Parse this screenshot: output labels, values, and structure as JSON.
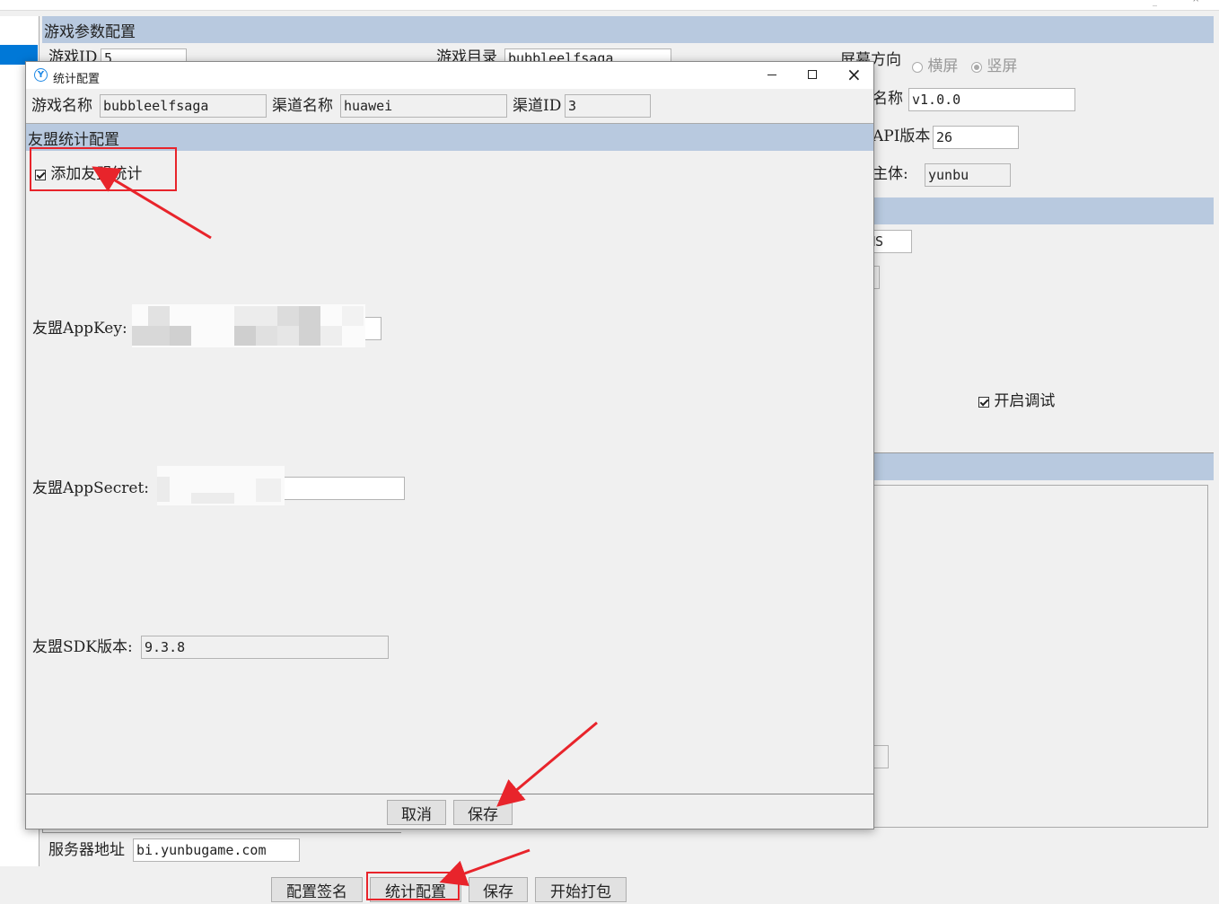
{
  "main_window": {
    "section_game_params": "游戏参数配置",
    "game_id_label": "游戏ID",
    "game_id_value": "5",
    "game_dir_label": "游戏目录",
    "game_dir_value": "bubbleelfsaga",
    "orientation_label": "屏幕方向",
    "orientation_landscape": "横屏",
    "orientation_portrait": "竖屏",
    "version_name_label": "名称",
    "version_name_value": "v1.0.0",
    "api_label": "API版本",
    "api_value": "26",
    "subject_label": "主体:",
    "subject_value": "yunbu",
    "ms_field_value": "MS",
    "debug_label": "开启调试",
    "server_label": "服务器地址",
    "server_value": "bi.yunbugame.com",
    "buttons": {
      "sign_config": "配置签名",
      "stats_config": "统计配置",
      "save": "保存",
      "start_pack": "开始打包"
    }
  },
  "dialog": {
    "title": "统计配置",
    "game_name_label": "游戏名称",
    "game_name_value": "bubbleelfsaga",
    "channel_name_label": "渠道名称",
    "channel_name_value": "huawei",
    "channel_id_label": "渠道ID",
    "channel_id_value": "3",
    "section_title": "友盟统计配置",
    "add_umeng_label": "添加友盟统计",
    "appkey_label": "友盟AppKey:",
    "appsecret_label": "友盟AppSecret:",
    "sdk_version_label": "友盟SDK版本:",
    "sdk_version_value": "9.3.8",
    "cancel_button": "取消",
    "save_button": "保存"
  },
  "colors": {
    "section_bar": "#b8c9df",
    "annotation_red": "#e8242b",
    "selection_blue": "#0078d7"
  }
}
